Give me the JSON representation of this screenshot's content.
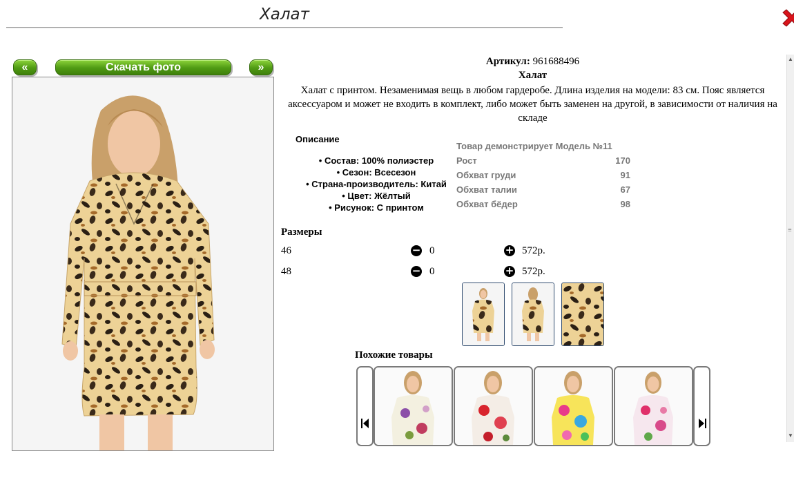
{
  "page": {
    "title": "Халат"
  },
  "gallery": {
    "prev_label": "«",
    "download_label": "Скачать фото",
    "next_label": "»"
  },
  "product": {
    "article_label": "Артикул:",
    "article_value": "961688496",
    "name": "Халат",
    "description": "Халат с принтом. Незаменимая вещь в любом гардеробе. Длина изделия на модели: 83 см. Пояс является аксессуаром и может не входить в комплект, либо может быть заменен на другой, в зависимости от наличия на складе"
  },
  "details": {
    "heading": "Описание",
    "items": [
      "Состав: 100% полиэстер",
      "Сезон: Всесезон",
      "Страна-производитель: Китай",
      "Цвет: Жёлтый",
      "Рисунок: С принтом"
    ]
  },
  "model_info": {
    "heading": "Товар демонстрирует Модель №11",
    "rows": [
      {
        "label": "Рост",
        "value": "170"
      },
      {
        "label": "Обхват груди",
        "value": "91"
      },
      {
        "label": "Обхват талии",
        "value": "67"
      },
      {
        "label": "Обхват бёдер",
        "value": "98"
      }
    ]
  },
  "sizes": {
    "heading": "Размеры",
    "rows": [
      {
        "size": "46",
        "qty": "0",
        "price": "572р."
      },
      {
        "size": "48",
        "qty": "0",
        "price": "572р."
      }
    ]
  },
  "similar": {
    "heading": "Похожие товары"
  },
  "icons": {
    "close": "close-x-icon",
    "minus": "minus-circle-icon",
    "plus": "plus-circle-icon",
    "first": "skip-first-icon",
    "last": "skip-last-icon"
  },
  "colors": {
    "button_green": "#5aa81b",
    "close_red": "#d8141b",
    "thumb_border": "#2e4a6e"
  }
}
